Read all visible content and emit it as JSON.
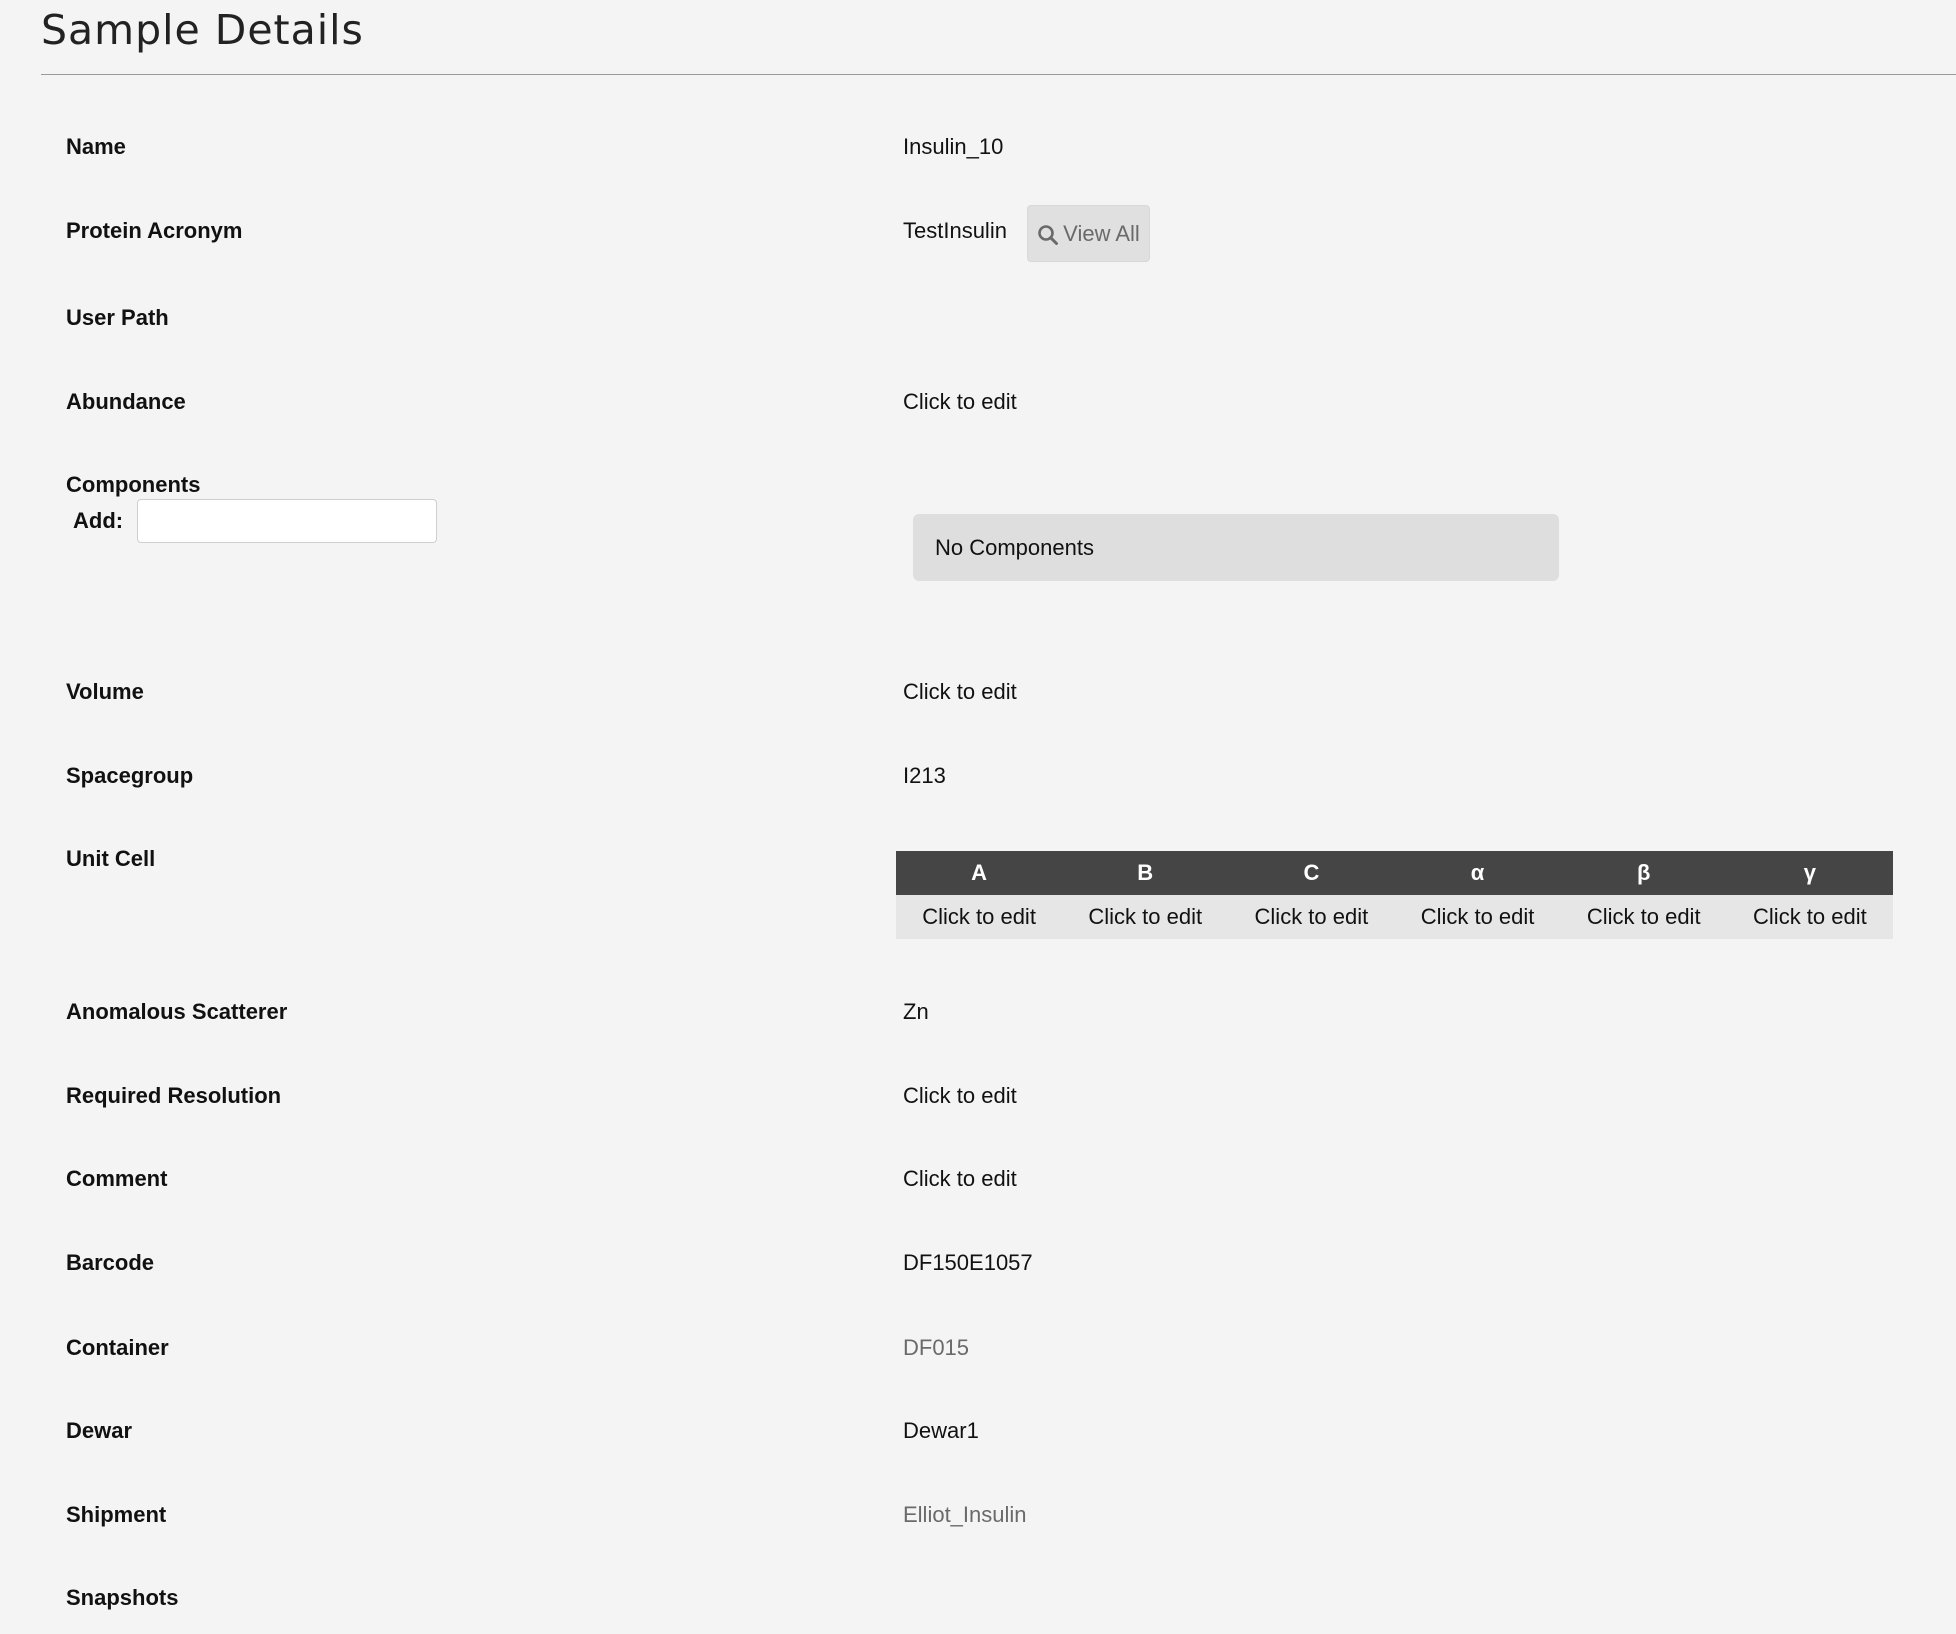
{
  "page": {
    "title": "Sample Details"
  },
  "fields": {
    "name": {
      "label": "Name",
      "value": "Insulin_10"
    },
    "protein_acronym": {
      "label": "Protein Acronym",
      "value": "TestInsulin",
      "view_all_label": "View All"
    },
    "user_path": {
      "label": "User Path",
      "value": ""
    },
    "abundance": {
      "label": "Abundance",
      "value": "Click to edit"
    },
    "components": {
      "label": "Components",
      "add_label": "Add:",
      "add_value": "",
      "empty_text": "No Components"
    },
    "volume": {
      "label": "Volume",
      "value": "Click to edit"
    },
    "spacegroup": {
      "label": "Spacegroup",
      "value": "I213"
    },
    "unit_cell": {
      "label": "Unit Cell",
      "headers": [
        "A",
        "B",
        "C",
        "α",
        "β",
        "γ"
      ],
      "values": [
        "Click to edit",
        "Click to edit",
        "Click to edit",
        "Click to edit",
        "Click to edit",
        "Click to edit"
      ]
    },
    "anomalous_scatterer": {
      "label": "Anomalous Scatterer",
      "value": "Zn"
    },
    "required_resolution": {
      "label": "Required Resolution",
      "value": "Click to edit"
    },
    "comment": {
      "label": "Comment",
      "value": "Click to edit"
    },
    "barcode": {
      "label": "Barcode",
      "value": "DF150E1057"
    },
    "container": {
      "label": "Container",
      "value": "DF015"
    },
    "dewar": {
      "label": "Dewar",
      "value": "Dewar1"
    },
    "shipment": {
      "label": "Shipment",
      "value": "Elliot_Insulin"
    },
    "snapshots": {
      "label": "Snapshots"
    }
  },
  "colors": {
    "background": "#f4f4f4",
    "table_header": "#454545",
    "table_row": "#e6e6e6",
    "link": "#6a6a6a"
  },
  "icons": {
    "view_all": "search-icon"
  }
}
